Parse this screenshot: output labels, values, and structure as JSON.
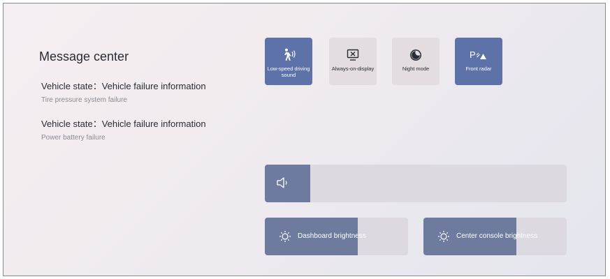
{
  "message_center": {
    "title": "Message center",
    "messages": [
      {
        "state": "Vehicle state：Vehicle failure information",
        "detail": "Tire pressure system failure"
      },
      {
        "state": "Vehicle state：Vehicle failure information",
        "detail": "Power battery failure"
      }
    ]
  },
  "quick_controls": [
    {
      "label": "Low-speed driving sound",
      "icon": "pedestrian-sound-icon",
      "active": true
    },
    {
      "label": "Always-on-display",
      "icon": "display-off-icon",
      "active": false
    },
    {
      "label": "Night mode",
      "icon": "night-mode-icon",
      "active": false
    },
    {
      "label": "Front radar",
      "icon": "front-radar-icon",
      "active": true
    }
  ],
  "volume": {
    "icon": "speaker-icon",
    "level": 0.15
  },
  "brightness": [
    {
      "label": "Dashboard brightness",
      "icon": "sun-icon",
      "level": 0.65
    },
    {
      "label": "Center console brightness",
      "icon": "sun-icon",
      "level": 0.65
    }
  ],
  "colors": {
    "active_tile": "#5d72a8",
    "inactive_tile": "#e3dde2",
    "slider_fill": "#6e7b9e",
    "slider_track": "#dcd9e0"
  }
}
